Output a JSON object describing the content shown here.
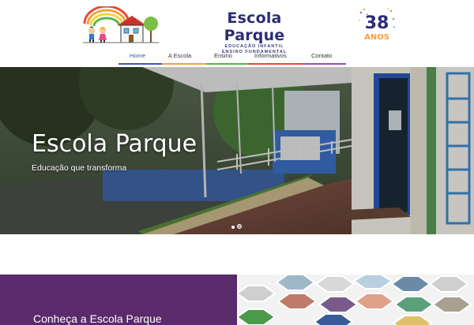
{
  "brand": {
    "name": "Escola Parque",
    "line1": "EDUCAÇÃO INFANTIL",
    "line2": "ENSINO FUNDAMENTAL",
    "badge_number": "38",
    "badge_word": "ANOS"
  },
  "nav": {
    "items": [
      {
        "label": "Home",
        "active": true
      },
      {
        "label": "A Escola",
        "active": false
      },
      {
        "label": "Ensino",
        "active": false
      },
      {
        "label": "Informativos",
        "active": false
      },
      {
        "label": "Contato",
        "active": false
      }
    ],
    "accent": "#3a56c8"
  },
  "hero": {
    "title": "Escola Parque",
    "subtitle": "Educação que transforma",
    "slides_total": 2,
    "slide_active": 1
  },
  "about": {
    "title": "Conheça a Escola Parque",
    "panel_color": "#5a2a6b"
  }
}
